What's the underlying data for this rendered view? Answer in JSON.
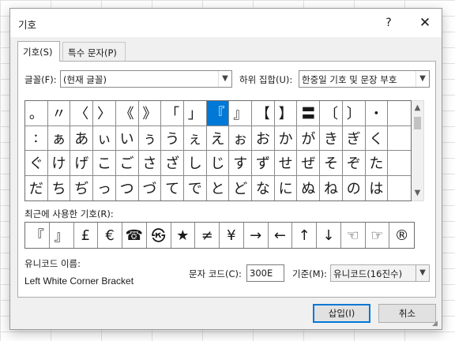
{
  "dialog": {
    "title": "기호",
    "help_label": "?",
    "close_label": "✕"
  },
  "tabs": [
    {
      "label": "기호(S)",
      "active": true
    },
    {
      "label": "특수 문자(P)",
      "active": false
    }
  ],
  "font": {
    "label": "글꼴(F):",
    "value": "(현재 글꼴)"
  },
  "subset": {
    "label": "하위 집합(U):",
    "value": "한중일 기호 및 문장 부호"
  },
  "symbol_grid": {
    "selected": "『",
    "rows": [
      [
        "。",
        "〃",
        "〈",
        "〉",
        "《",
        "》",
        "「",
        "」",
        "『",
        "』",
        "【",
        "】",
        "〓",
        "〔",
        "〕",
        "・",
        ""
      ],
      [
        "ː",
        "ぁ",
        "あ",
        "ぃ",
        "い",
        "ぅ",
        "う",
        "ぇ",
        "え",
        "ぉ",
        "お",
        "か",
        "が",
        "き",
        "ぎ",
        "く",
        ""
      ],
      [
        "ぐ",
        "け",
        "げ",
        "こ",
        "ご",
        "さ",
        "ざ",
        "し",
        "じ",
        "す",
        "ず",
        "せ",
        "ぜ",
        "そ",
        "ぞ",
        "た",
        ""
      ],
      [
        "だ",
        "ち",
        "ぢ",
        "っ",
        "つ",
        "づ",
        "て",
        "で",
        "と",
        "ど",
        "な",
        "に",
        "ぬ",
        "ね",
        "の",
        "は",
        ""
      ]
    ]
  },
  "recent": {
    "label": "최근에 사용한 기호(R):",
    "symbols": [
      "『",
      "』",
      "£",
      "€",
      "☎",
      "㉿",
      "★",
      "≠",
      "¥",
      "→",
      "←",
      "↑",
      "↓",
      "☜",
      "☞",
      "®"
    ]
  },
  "unicode_name": {
    "label": "유니코드 이름:",
    "value": "Left White Corner Bracket"
  },
  "char_code": {
    "label": "문자 코드(C):",
    "value": "300E"
  },
  "basis": {
    "label": "기준(M):",
    "value": "유니코드(16진수)"
  },
  "buttons": {
    "insert": "삽입(I)",
    "cancel": "취소"
  },
  "icons": {
    "dropdown": "chevron-down-icon",
    "scroll_up": "chevron-up-icon",
    "scroll_down": "chevron-down-icon",
    "close": "close-icon",
    "resize": "resize-grip-icon"
  },
  "colors": {
    "selection": "#0078d7",
    "default_button_border": "#0078d7",
    "dialog_bg": "#f0f0f0"
  }
}
